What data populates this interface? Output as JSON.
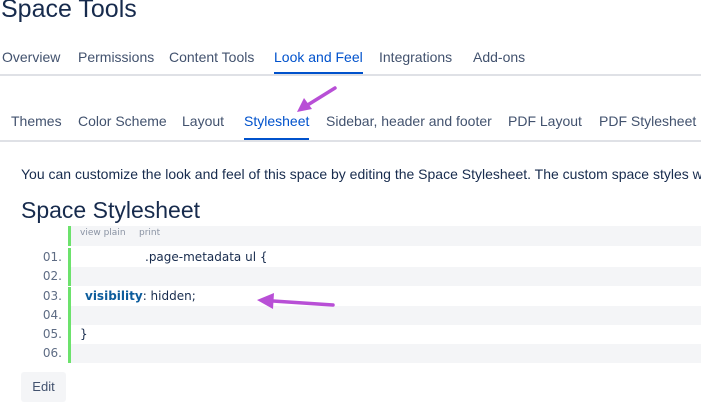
{
  "header": {
    "title": "Space Tools"
  },
  "main_tabs": [
    {
      "label": "Overview",
      "active": false
    },
    {
      "label": "Permissions",
      "active": false
    },
    {
      "label": "Content Tools",
      "active": false
    },
    {
      "label": "Look and Feel",
      "active": true
    },
    {
      "label": "Integrations",
      "active": false
    },
    {
      "label": "Add-ons",
      "active": false
    }
  ],
  "sub_tabs": [
    {
      "label": "Themes",
      "active": false
    },
    {
      "label": "Color Scheme",
      "active": false
    },
    {
      "label": "Layout",
      "active": false
    },
    {
      "label": "Stylesheet",
      "active": true
    },
    {
      "label": "Sidebar, header and footer",
      "active": false
    },
    {
      "label": "PDF Layout",
      "active": false
    },
    {
      "label": "PDF Stylesheet",
      "active": false
    }
  ],
  "content": {
    "intro": "You can customize the look and feel of this space by editing the Space Stylesheet. The custom space styles will c",
    "section_title": "Space Stylesheet",
    "code_toolbar": {
      "view_plain": "view plain",
      "print": "print"
    },
    "code_lines": [
      {
        "num": "01.",
        "text": ".page-metadata ul {"
      },
      {
        "num": "02.",
        "text": ""
      },
      {
        "num": "03.",
        "keyword": "visibility",
        "text": ": hidden;"
      },
      {
        "num": "04.",
        "text": ""
      },
      {
        "num": "05.",
        "text": "}"
      },
      {
        "num": "06.",
        "text": ""
      }
    ],
    "edit_label": "Edit"
  },
  "colors": {
    "accent": "#0052cc",
    "text": "#172b4d",
    "gutter_bar": "#6ce26c",
    "annotation_arrow": "#b84fd6"
  },
  "annotations": [
    "purple-arrow-to-stylesheet-tab",
    "purple-arrow-to-visibility-line"
  ]
}
